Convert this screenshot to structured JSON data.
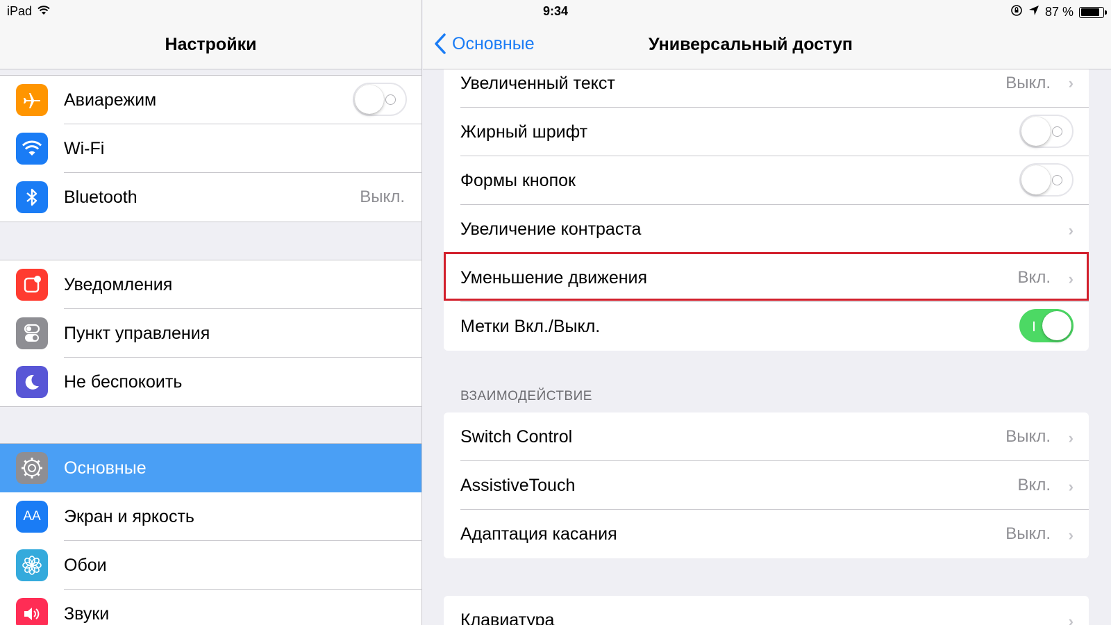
{
  "status_bar": {
    "device": "iPad",
    "time": "9:34",
    "battery": "87 %",
    "battery_level": 0.87
  },
  "left_pane": {
    "title": "Настройки",
    "groups": [
      {
        "items": [
          {
            "label": "Авиарежим",
            "icon": "airplane-icon",
            "color": "#ff9500",
            "toggle": false
          },
          {
            "label": "Wi-Fi",
            "icon": "wifi-icon",
            "color": "#1a7cf5"
          },
          {
            "label": "Bluetooth",
            "icon": "bluetooth-icon",
            "color": "#1a7cf5",
            "value": "Выкл."
          }
        ]
      },
      {
        "items": [
          {
            "label": "Уведомления",
            "icon": "notifications-icon",
            "color": "#ff3b30"
          },
          {
            "label": "Пункт управления",
            "icon": "control-center-icon",
            "color": "#8e8e93"
          },
          {
            "label": "Не беспокоить",
            "icon": "moon-icon",
            "color": "#5856d6"
          }
        ]
      },
      {
        "items": [
          {
            "label": "Основные",
            "icon": "gear-icon",
            "color": "#8e8e93",
            "selected": true
          },
          {
            "label": "Экран и яркость",
            "icon": "display-icon",
            "color": "#1a7cf5",
            "icon_text": "AA"
          },
          {
            "label": "Обои",
            "icon": "wallpaper-icon",
            "color": "#34aadc"
          },
          {
            "label": "Звуки",
            "icon": "sounds-icon",
            "color": "#ff2d55"
          }
        ]
      }
    ]
  },
  "right_pane": {
    "back_label": "Основные",
    "title": "Универсальный доступ",
    "group1": [
      {
        "label": "Увеличенный текст",
        "value": "Выкл."
      },
      {
        "label": "Жирный шрифт",
        "toggle": false
      },
      {
        "label": "Формы кнопок",
        "toggle": false
      },
      {
        "label": "Увеличение контраста"
      },
      {
        "label": "Уменьшение движения",
        "value": "Вкл.",
        "highlighted": true
      },
      {
        "label": "Метки Вкл./Выкл.",
        "toggle": true
      }
    ],
    "section_interaction": "ВЗАИМОДЕЙСТВИЕ",
    "group2": [
      {
        "label": "Switch Control",
        "value": "Выкл."
      },
      {
        "label": "AssistiveTouch",
        "value": "Вкл."
      },
      {
        "label": "Адаптация касания",
        "value": "Выкл."
      }
    ],
    "group3": [
      {
        "label": "Клавиатура"
      }
    ],
    "colors": {
      "accent": "#1a7cf5",
      "highlight": "#d21f2c",
      "toggle_on": "#4cd964",
      "selected_row": "#4a9ff5"
    }
  }
}
